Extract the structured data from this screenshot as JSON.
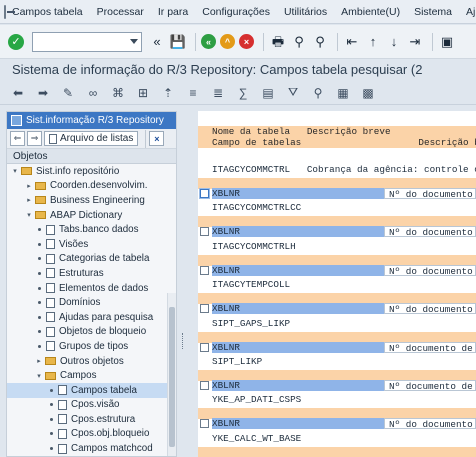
{
  "menubar": {
    "items": [
      "Campos tabela",
      "Processar",
      "Ir para",
      "Configurações",
      "Utilitários",
      "Ambiente(U)",
      "Sistema",
      "Aj"
    ]
  },
  "toolbar": {
    "command_value": "",
    "sep_icon": "back-arrows-icon"
  },
  "title": "Sistema de informação do R/3 Repository: Campos tabela pesquisar (2",
  "left": {
    "header": "Sist.informação R/3 Repository",
    "archive_button": "Arquivo de listas",
    "objects_label": "Objetos",
    "tree": [
      {
        "label": "Sist.info repositório",
        "level": 0,
        "kind": "folder",
        "expanded": true
      },
      {
        "label": "Coorden.desenvolvim.",
        "level": 1,
        "kind": "folder",
        "expanded": false
      },
      {
        "label": "Business Engineering",
        "level": 1,
        "kind": "folder",
        "expanded": false
      },
      {
        "label": "ABAP Dictionary",
        "level": 1,
        "kind": "folder",
        "expanded": true
      },
      {
        "label": "Tabs.banco dados",
        "level": 2,
        "kind": "doc"
      },
      {
        "label": "Visões",
        "level": 2,
        "kind": "doc"
      },
      {
        "label": "Categorias de tabela",
        "level": 2,
        "kind": "doc"
      },
      {
        "label": "Estruturas",
        "level": 2,
        "kind": "doc"
      },
      {
        "label": "Elementos de dados",
        "level": 2,
        "kind": "doc"
      },
      {
        "label": "Domínios",
        "level": 2,
        "kind": "doc"
      },
      {
        "label": "Ajudas para pesquisa",
        "level": 2,
        "kind": "doc"
      },
      {
        "label": "Objetos de bloqueio",
        "level": 2,
        "kind": "doc"
      },
      {
        "label": "Grupos de tipos",
        "level": 2,
        "kind": "doc"
      },
      {
        "label": "Outros objetos",
        "level": 2,
        "kind": "folder",
        "expanded": false
      },
      {
        "label": "Campos",
        "level": 2,
        "kind": "folder",
        "expanded": true
      },
      {
        "label": "Campos tabela",
        "level": 3,
        "kind": "doc",
        "selected": true
      },
      {
        "label": "Cpos.visão",
        "level": 3,
        "kind": "doc"
      },
      {
        "label": "Cpos.estrutura",
        "level": 3,
        "kind": "doc"
      },
      {
        "label": "Cpos.obj.bloqueio",
        "level": 3,
        "kind": "doc"
      },
      {
        "label": "Campos matchcod",
        "level": 3,
        "kind": "doc"
      }
    ]
  },
  "list": {
    "header1": "Nome da tabela   Descrição breve",
    "header2": "Campo de tabelas                     Descrição breve",
    "rows": [
      {
        "table": "ITAGCYCOMMCTRL   Cobrança da agência: controle c",
        "field": "XBLNR",
        "desc": "Nº do documento c"
      },
      {
        "table": "ITAGCYCOMMCTRLCC",
        "field": "XBLNR",
        "desc": "Nº do documento c"
      },
      {
        "table": "ITAGCYCOMMCTRLH",
        "field": "XBLNR",
        "desc": "Nº do documento c"
      },
      {
        "table": "ITAGCYTEMPCOLL",
        "field": "XBLNR",
        "desc": "Nº do documento c"
      },
      {
        "table": "SIPT_GAPS_LIKP",
        "field": "XBLNR",
        "desc": "Nº documento de"
      },
      {
        "table": "SIPT_LIKP",
        "field": "XBLNR",
        "desc": "Nº documento de"
      },
      {
        "table": "YKE_AP_DATI_CSPS",
        "field": "XBLNR",
        "desc": "Nº do documento c"
      },
      {
        "table": "YKE_CALC_WT_BASE",
        "field": "XBLNR",
        "desc": "Nº documento de"
      }
    ]
  },
  "colors": {
    "accent": "#3c77c4",
    "header_orange": "#fbd3a8",
    "field_blue": "#8fb4e8",
    "selected": "#c6dbf3"
  }
}
